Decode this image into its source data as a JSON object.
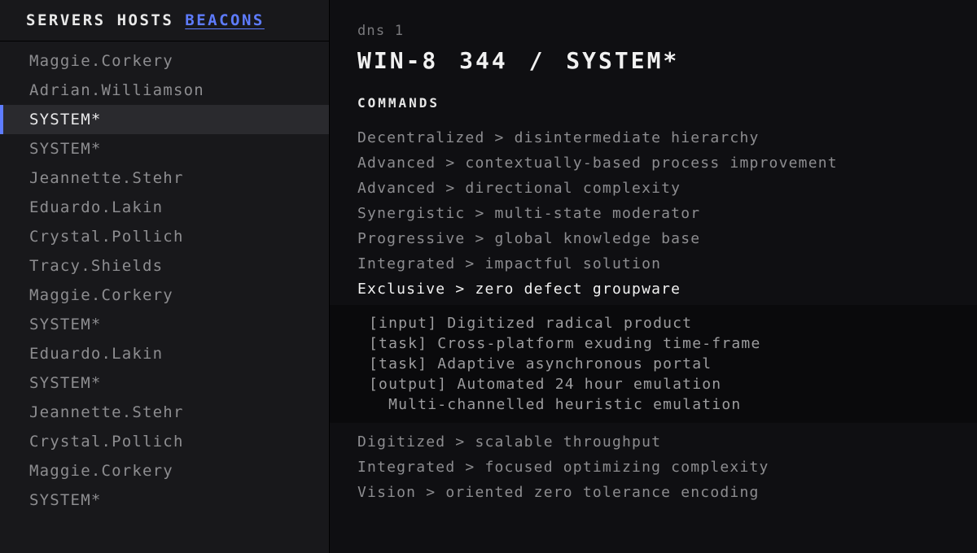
{
  "sidebar": {
    "tabs": [
      {
        "label": "SERVERS",
        "active": false
      },
      {
        "label": "HOSTS",
        "active": false
      },
      {
        "label": "BEACONS",
        "active": true
      }
    ],
    "items": [
      {
        "label": "Maggie.Corkery",
        "selected": false
      },
      {
        "label": "Adrian.Williamson",
        "selected": false
      },
      {
        "label": "SYSTEM*",
        "selected": true
      },
      {
        "label": "SYSTEM*",
        "selected": false
      },
      {
        "label": "Jeannette.Stehr",
        "selected": false
      },
      {
        "label": "Eduardo.Lakin",
        "selected": false
      },
      {
        "label": "Crystal.Pollich",
        "selected": false
      },
      {
        "label": "Tracy.Shields",
        "selected": false
      },
      {
        "label": "Maggie.Corkery",
        "selected": false
      },
      {
        "label": "SYSTEM*",
        "selected": false
      },
      {
        "label": "Eduardo.Lakin",
        "selected": false
      },
      {
        "label": "SYSTEM*",
        "selected": false
      },
      {
        "label": "Jeannette.Stehr",
        "selected": false
      },
      {
        "label": "Crystal.Pollich",
        "selected": false
      },
      {
        "label": "Maggie.Corkery",
        "selected": false
      },
      {
        "label": "SYSTEM*",
        "selected": false
      }
    ]
  },
  "main": {
    "subtitle": "dns 1",
    "title": "WIN-8 344 / SYSTEM*",
    "section_label": "COMMANDS",
    "commands": [
      {
        "text": "Decentralized > disintermediate hierarchy"
      },
      {
        "text": "Advanced > contextually-based process improvement"
      },
      {
        "text": "Advanced > directional complexity"
      },
      {
        "text": "Synergistic > multi-state moderator"
      },
      {
        "text": "Progressive > global knowledge base"
      },
      {
        "text": "Integrated > impactful solution"
      },
      {
        "text": "Exclusive > zero defect groupware",
        "expanded": true,
        "detail": [
          "[input] Digitized radical product",
          "[task] Cross-platform exuding time-frame",
          "[task] Adaptive asynchronous portal",
          "[output] Automated 24 hour emulation",
          "  Multi-channelled heuristic emulation"
        ]
      },
      {
        "text": "Digitized > scalable throughput"
      },
      {
        "text": "Integrated > focused optimizing complexity"
      },
      {
        "text": "Vision > oriented zero tolerance encoding"
      }
    ]
  }
}
